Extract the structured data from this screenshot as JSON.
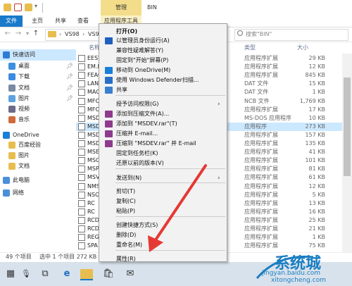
{
  "window": {
    "title": "BIN",
    "contextual_group": "管理",
    "tabs": [
      "文件",
      "主页",
      "共享",
      "查看"
    ],
    "contextual_tab": "应用程序工具"
  },
  "address": {
    "crumbs": [
      "VS98",
      "VS98"
    ],
    "search_placeholder": "搜索\"BIN\""
  },
  "nav": {
    "items": [
      {
        "label": "快速访问",
        "icon": "star-icon",
        "pinned": false
      },
      {
        "label": "桌面",
        "icon": "desktop-icon",
        "pinned": true
      },
      {
        "label": "下载",
        "icon": "download-icon",
        "pinned": true
      },
      {
        "label": "文档",
        "icon": "document-icon",
        "pinned": true
      },
      {
        "label": "图片",
        "icon": "picture-icon",
        "pinned": true
      },
      {
        "label": "视频",
        "icon": "video-icon",
        "pinned": false
      },
      {
        "label": "音乐",
        "icon": "music-icon",
        "pinned": false
      },
      {
        "label": "OneDrive",
        "icon": "onedrive-icon",
        "pinned": false
      },
      {
        "label": "百度经验",
        "icon": "folder-icon",
        "pinned": false
      },
      {
        "label": "图片",
        "icon": "folder-icon",
        "pinned": false
      },
      {
        "label": "文档",
        "icon": "folder-icon",
        "pinned": false
      },
      {
        "label": "此电脑",
        "icon": "computer-icon",
        "pinned": false
      },
      {
        "label": "网络",
        "icon": "network-icon",
        "pinned": false
      }
    ]
  },
  "list": {
    "headers": {
      "name": "名称",
      "type": "类型",
      "size": "大小"
    },
    "rows": [
      {
        "name": "EESW",
        "type": "应用程序扩展",
        "size": "29 KB",
        "selected": false
      },
      {
        "name": "EM.D",
        "type": "应用程序扩展",
        "size": "12 KB",
        "selected": false
      },
      {
        "name": "FEAC",
        "type": "应用程序扩展",
        "size": "845 KB",
        "selected": false
      },
      {
        "name": "LANG",
        "type": "DAT 文件",
        "size": "15 KB",
        "selected": false
      },
      {
        "name": "MACR",
        "type": "DAT 文件",
        "size": "1 KB",
        "selected": false
      },
      {
        "name": "MFCA",
        "type": "NCB 文件",
        "size": "1,769 KB",
        "selected": false
      },
      {
        "name": "MFCT",
        "type": "应用程序扩展",
        "size": "17 KB",
        "selected": false
      },
      {
        "name": "MSDE",
        "type": "MS-DOS 应用程序",
        "size": "10 KB",
        "selected": false
      },
      {
        "name": "MSDE",
        "type": "应用程序",
        "size": "273 KB",
        "selected": true
      },
      {
        "name": "MSDE",
        "type": "应用程序扩展",
        "size": "157 KB",
        "selected": false
      },
      {
        "name": "MSDE",
        "type": "应用程序扩展",
        "size": "135 KB",
        "selected": false
      },
      {
        "name": "MSEN",
        "type": "应用程序扩展",
        "size": "41 KB",
        "selected": false
      },
      {
        "name": "MSOB",
        "type": "应用程序扩展",
        "size": "101 KB",
        "selected": false
      },
      {
        "name": "MSPD",
        "type": "应用程序扩展",
        "size": "81 KB",
        "selected": false
      },
      {
        "name": "MSVC",
        "type": "应用程序扩展",
        "size": "61 KB",
        "selected": false
      },
      {
        "name": "NMSC",
        "type": "应用程序扩展",
        "size": "12 KB",
        "selected": false
      },
      {
        "name": "NSOD",
        "type": "应用程序扩展",
        "size": "5 KB",
        "selected": false
      },
      {
        "name": "RC",
        "type": "应用程序扩展",
        "size": "13 KB",
        "selected": false
      },
      {
        "name": "RC",
        "type": "应用程序扩展",
        "size": "16 KB",
        "selected": false
      },
      {
        "name": "RCDL",
        "type": "应用程序扩展",
        "size": "25 KB",
        "selected": false
      },
      {
        "name": "RCDL",
        "type": "应用程序扩展",
        "size": "21 KB",
        "selected": false
      },
      {
        "name": "REGS",
        "type": "应用程序扩展",
        "size": "1 KB",
        "selected": false
      },
      {
        "name": "SPA",
        "type": "应用程序扩展",
        "size": "75 KB",
        "selected": false
      }
    ]
  },
  "context_menu": {
    "items": [
      {
        "label": "打开(O)",
        "bold": true,
        "icon": "",
        "submenu": false
      },
      {
        "label": "以管理员身份运行(A)",
        "bold": false,
        "icon": "shield-icon",
        "submenu": false
      },
      {
        "label": "兼容性疑难解答(Y)",
        "bold": false,
        "icon": "",
        "submenu": false
      },
      {
        "label": "固定到\"开始\"屏幕(P)",
        "bold": false,
        "icon": "",
        "submenu": false
      },
      {
        "label": "移动到 OneDrive(M)",
        "bold": false,
        "icon": "onedrive-icon",
        "submenu": false
      },
      {
        "label": "使用 Windows Defender扫描...",
        "bold": false,
        "icon": "defender-icon",
        "submenu": false
      },
      {
        "label": "共享",
        "bold": false,
        "icon": "share-icon",
        "submenu": false
      },
      {
        "label": "授予访问权限(G)",
        "bold": false,
        "icon": "",
        "submenu": true
      },
      {
        "label": "添加到压缩文件(A)...",
        "bold": false,
        "icon": "winrar-icon",
        "submenu": false
      },
      {
        "label": "添加到 \"MSDEV.rar\"(T)",
        "bold": false,
        "icon": "winrar-icon",
        "submenu": false
      },
      {
        "label": "压缩并 E-mail...",
        "bold": false,
        "icon": "winrar-icon",
        "submenu": false
      },
      {
        "label": "压缩到 \"MSDEV.rar\" 并 E-mail",
        "bold": false,
        "icon": "winrar-icon",
        "submenu": false
      },
      {
        "label": "固定到任务栏(K)",
        "bold": false,
        "icon": "",
        "submenu": false
      },
      {
        "label": "还原以前的版本(V)",
        "bold": false,
        "icon": "",
        "submenu": false
      },
      {
        "label": "发送到(N)",
        "bold": false,
        "icon": "",
        "submenu": true
      },
      {
        "label": "剪切(T)",
        "bold": false,
        "icon": "",
        "submenu": false
      },
      {
        "label": "复制(C)",
        "bold": false,
        "icon": "",
        "submenu": false
      },
      {
        "label": "粘贴(P)",
        "bold": false,
        "icon": "",
        "submenu": false
      },
      {
        "label": "创建快捷方式(S)",
        "bold": false,
        "icon": "",
        "submenu": false
      },
      {
        "label": "删除(D)",
        "bold": false,
        "icon": "",
        "submenu": false
      },
      {
        "label": "重命名(M)",
        "bold": false,
        "icon": "",
        "submenu": false
      },
      {
        "label": "属性(R)",
        "bold": false,
        "icon": "",
        "submenu": false
      }
    ]
  },
  "status": {
    "item_count": "49 个项目",
    "selected": "选中 1 个项目  272 KB"
  },
  "watermark": {
    "brand": "系统城",
    "url1": "jingyan.baidu.com",
    "url2": "xitongcheng.com"
  },
  "colors": {
    "accent": "#1979ca",
    "selection": "#cce8ff",
    "manage_tab": "#f3dd8a",
    "arrow": "#e53935"
  }
}
